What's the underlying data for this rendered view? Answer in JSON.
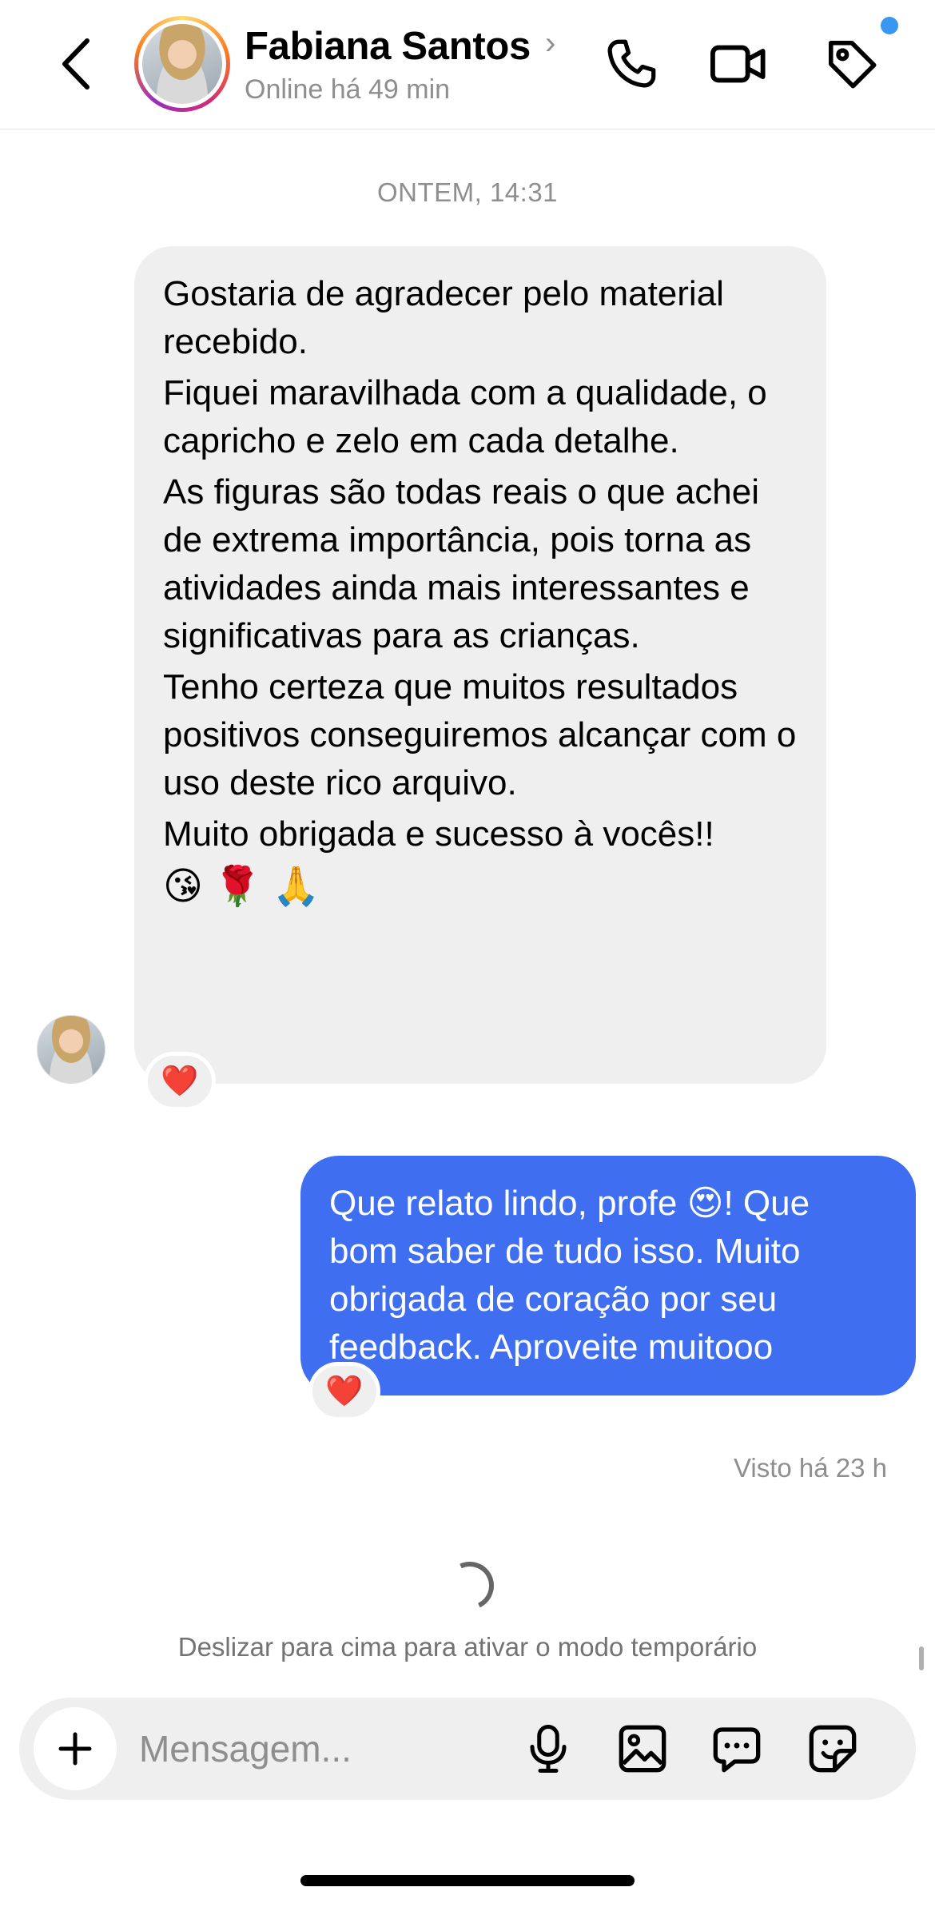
{
  "header": {
    "contact_name": "Fabiana Santos",
    "status": "Online há 49 min",
    "chevron": "›",
    "icons": [
      "back-icon",
      "phone-icon",
      "video-icon",
      "tag-icon"
    ],
    "notification_dot_color": "#3897f0"
  },
  "chat": {
    "timestamp": "ONTEM, 14:31",
    "incoming": {
      "paragraphs": [
        "Gostaria de agradecer pelo material recebido.",
        "Fiquei maravilhada com a qualidade, o capricho e zelo em cada detalhe.",
        "As figuras são todas reais o que achei de extrema importância, pois torna as atividades ainda mais interessantes e significativas para as crianças.",
        "Tenho certeza que muitos resultados positivos conseguiremos alcançar com o uso deste rico arquivo.",
        "Muito obrigada e sucesso à vocês!!"
      ],
      "emojis": "😘 🌹 🙏",
      "reaction": "❤️",
      "bubble_color": "#efefef"
    },
    "outgoing": {
      "text": "Que relato lindo, profe 😍! Que bom saber de tudo isso. Muito obrigada de coração por seu feedback. Aproveite muitooo",
      "reaction": "❤️",
      "bubble_color": "#3f6ff0"
    },
    "seen": "Visto há 23 h",
    "hint": "Deslizar para cima para ativar o modo temporário"
  },
  "composer": {
    "placeholder": "Mensagem...",
    "plus_label": "+",
    "icons": [
      "microphone-icon",
      "gallery-icon",
      "chat-bubble-icon",
      "sticker-icon"
    ]
  }
}
